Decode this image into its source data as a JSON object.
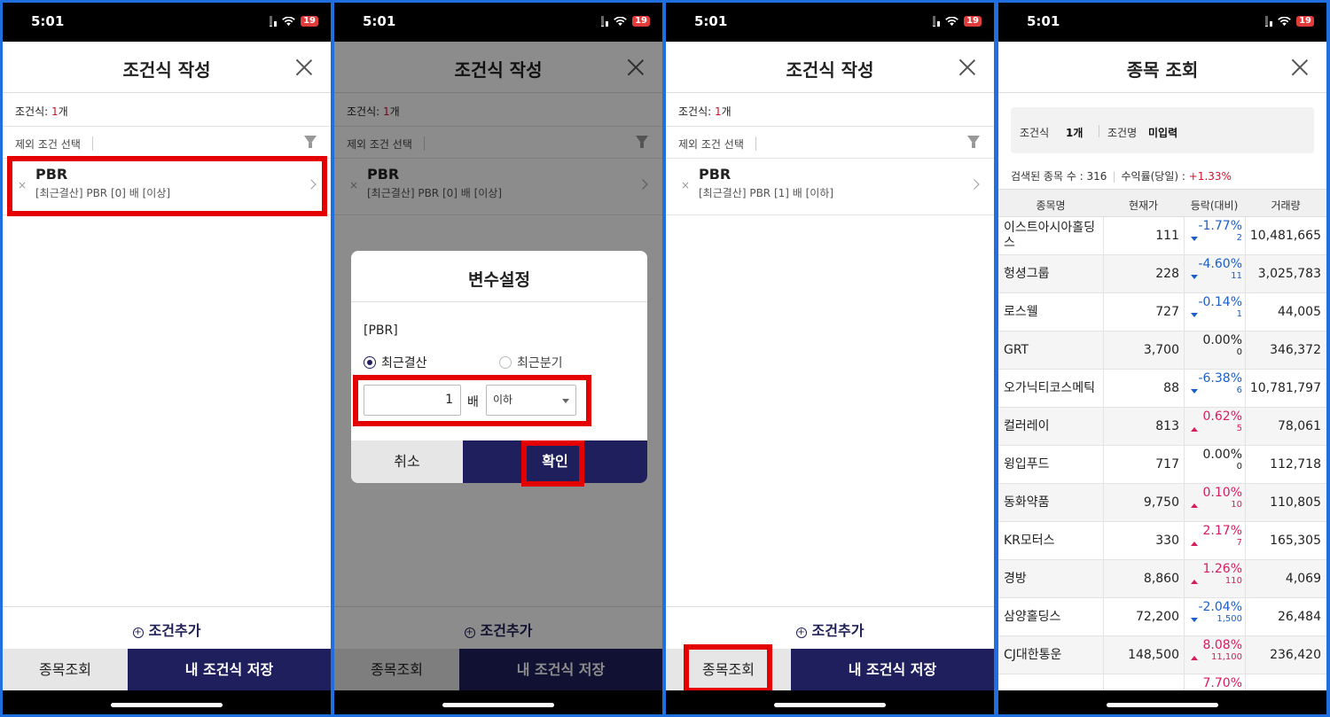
{
  "status": {
    "time": "5:01",
    "battery": "19"
  },
  "screen1": {
    "title": "조건식 작성",
    "cond_count_label": "조건식: ",
    "cond_count_value": "1",
    "cond_count_unit": "개",
    "exclude_label": "제외 조건 선택",
    "condition": {
      "remove": "×",
      "name": "PBR",
      "desc": "[최근결산] PBR [0] 배 [이상]"
    },
    "add_label": "조건추가",
    "search_button": "종목조회",
    "save_button": "내 조건식 저장"
  },
  "screen2": {
    "title": "조건식 작성",
    "cond_count_label": "조건식: ",
    "cond_count_value": "1",
    "cond_count_unit": "개",
    "exclude_label": "제외 조건 선택",
    "condition": {
      "remove": "×",
      "name": "PBR",
      "desc": "[최근결산] PBR [0] 배 [이상]"
    },
    "add_label": "조건추가",
    "search_button": "종목조회",
    "save_button": "내 조건식 저장",
    "modal": {
      "title": "변수설정",
      "label": "[PBR]",
      "radio_recent_settle": "최근결산",
      "radio_recent_quarter": "최근분기",
      "value": "1",
      "unit": "배",
      "select_value": "이하",
      "cancel": "취소",
      "ok": "확인"
    }
  },
  "screen3": {
    "title": "조건식 작성",
    "cond_count_label": "조건식: ",
    "cond_count_value": "1",
    "cond_count_unit": "개",
    "exclude_label": "제외 조건 선택",
    "condition": {
      "remove": "×",
      "name": "PBR",
      "desc": "[최근결산] PBR [1] 배 [이하]"
    },
    "add_label": "조건추가",
    "search_button": "종목조회",
    "save_button": "내 조건식 저장"
  },
  "screen4": {
    "title": "종목 조회",
    "summary": {
      "cond_label": "조건식",
      "cond_value": "1개",
      "name_label": "조건명",
      "name_value": "미입력"
    },
    "found_label": "검색된 종목 수 : 316",
    "return_label": "수익률(당일) : ",
    "return_value": "+1.33%",
    "columns": [
      "종목명",
      "현재가",
      "등락(대비)",
      "거래량"
    ],
    "rows": [
      {
        "name": "이스트아시아홀딩스",
        "price": "111",
        "pct": "-1.77%",
        "diff": "2",
        "dir": "down",
        "volume": "10,481,665"
      },
      {
        "name": "헝셩그룹",
        "price": "228",
        "pct": "-4.60%",
        "diff": "11",
        "dir": "down",
        "volume": "3,025,783"
      },
      {
        "name": "로스웰",
        "price": "727",
        "pct": "-0.14%",
        "diff": "1",
        "dir": "down",
        "volume": "44,005"
      },
      {
        "name": "GRT",
        "price": "3,700",
        "pct": "0.00%",
        "diff": "0",
        "dir": "flat",
        "volume": "346,372"
      },
      {
        "name": "오가닉티코스메틱",
        "price": "88",
        "pct": "-6.38%",
        "diff": "6",
        "dir": "down",
        "volume": "10,781,797"
      },
      {
        "name": "컬러레이",
        "price": "813",
        "pct": "0.62%",
        "diff": "5",
        "dir": "up",
        "volume": "78,061"
      },
      {
        "name": "윙입푸드",
        "price": "717",
        "pct": "0.00%",
        "diff": "0",
        "dir": "flat",
        "volume": "112,718"
      },
      {
        "name": "동화약품",
        "price": "9,750",
        "pct": "0.10%",
        "diff": "10",
        "dir": "up",
        "volume": "110,805"
      },
      {
        "name": "KR모터스",
        "price": "330",
        "pct": "2.17%",
        "diff": "7",
        "dir": "up",
        "volume": "165,305"
      },
      {
        "name": "경방",
        "price": "8,860",
        "pct": "1.26%",
        "diff": "110",
        "dir": "up",
        "volume": "4,069"
      },
      {
        "name": "삼양홀딩스",
        "price": "72,200",
        "pct": "-2.04%",
        "diff": "1,500",
        "dir": "down",
        "volume": "26,484"
      },
      {
        "name": "CJ대한통운",
        "price": "148,500",
        "pct": "8.08%",
        "diff": "11,100",
        "dir": "up",
        "volume": "236,420"
      },
      {
        "name": "",
        "price": "",
        "pct": "7.70%",
        "diff": "",
        "dir": "up",
        "volume": ""
      }
    ]
  },
  "colors": {
    "navy": "#1f1f5e",
    "red_highlight": "#e50000",
    "down": "#1a5fc8",
    "up": "#d81b60",
    "frame": "#1f6fe0"
  }
}
